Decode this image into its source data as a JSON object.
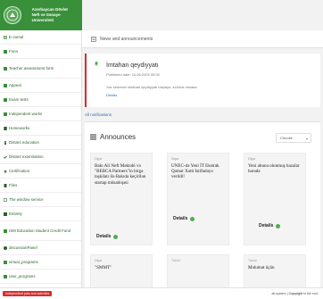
{
  "header": {
    "title": "Azərbaycan Dövlət",
    "subtitle": "Neft və Sənaye Universiteti"
  },
  "sidebar": {
    "items": [
      {
        "label": "E-Jurnal"
      },
      {
        "label": "Fənn"
      },
      {
        "label": "Teacher assessment form"
      },
      {
        "label": "Appeal"
      },
      {
        "label": "Exam tests"
      },
      {
        "label": "Independent works"
      },
      {
        "label": "Homeworks"
      },
      {
        "label": "Distant education"
      },
      {
        "label": "Distant examination"
      },
      {
        "label": "Certification"
      },
      {
        "label": "Files"
      },
      {
        "label": "The window service"
      },
      {
        "label": "Entirely"
      },
      {
        "label": "ISM Education Student Credit Fund"
      },
      {
        "label": "discussionPanel"
      },
      {
        "label": "virtual_programs"
      },
      {
        "label": "user_programs"
      }
    ]
  },
  "topbar": {
    "title": "News and announcements"
  },
  "exam": {
    "title": "İmtahan qeydiyyatı",
    "date": "Published date: 10.06.2025 09:30",
    "text": "Yaz semestri imtahan qeydiyyatı başlayır, zəhmət olmasa",
    "link": "Details"
  },
  "all_notifications": "All notifications",
  "announcements": {
    "title": "Announces",
    "filter": "Choose",
    "cards": [
      {
        "category": "Digər",
        "text": "Bakı Ali Neft Məktəbi və \"BEBCA Partners\"in birgə təşkilatı ilə Bakıda keçirilən startap müsabiqəsi",
        "details": "Details"
      },
      {
        "category": "Digər",
        "text": "UNEC-də Yeni İT Ekstrak Qəmər Xətti Istifadəyə verildi!",
        "details": "Details"
      },
      {
        "category": "Digər",
        "text": "Yeni abunə olunmuş bazalar barədə",
        "details": "Details"
      },
      {
        "category": "Digər",
        "text": "\"SMMT\"",
        "details": ""
      },
      {
        "category": "Təhsil",
        "text": "",
        "details": ""
      },
      {
        "category": "Təhsil",
        "text": "Məlumat üçün",
        "details": ""
      }
    ]
  },
  "footer": {
    "left": "Independent jobs and activities",
    "right_company": "all-system",
    "right_text": "Copyright",
    "right_tail": "to the end"
  }
}
